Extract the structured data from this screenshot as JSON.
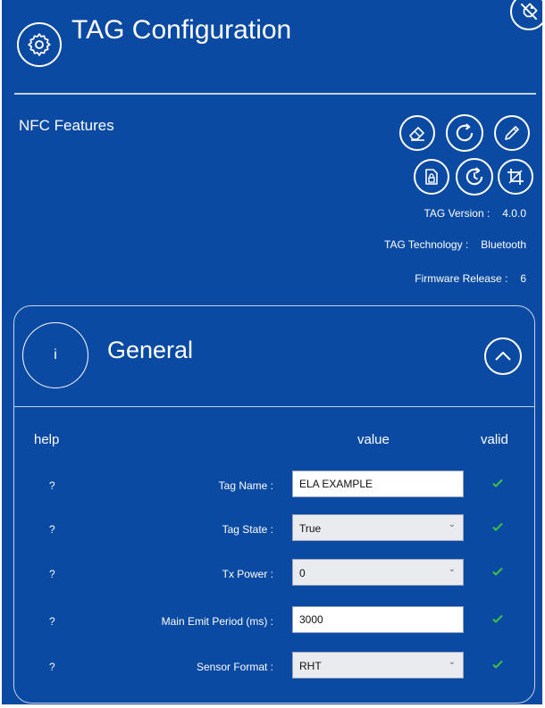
{
  "header": {
    "title": "TAG Configuration"
  },
  "nfc": {
    "title": "NFC Features",
    "info": [
      {
        "label": "TAG Version :",
        "value": "4.0.0"
      },
      {
        "label": "TAG Technology :",
        "value": "Bluetooth"
      },
      {
        "label": "Firmware Release :",
        "value": "6"
      }
    ]
  },
  "general": {
    "info_label": "i",
    "title": "General",
    "columns": {
      "help": "help",
      "value": "value",
      "valid": "valid"
    },
    "rows": [
      {
        "help": "?",
        "label": "Tag Name :",
        "value": "ELA EXAMPLE"
      },
      {
        "help": "?",
        "label": "Tag State :",
        "value": "True"
      },
      {
        "help": "?",
        "label": "Tx Power :",
        "value": "0"
      },
      {
        "help": "?",
        "label": "Main Emit Period (ms) :",
        "value": "3000"
      },
      {
        "help": "?",
        "label": "Sensor Format :",
        "value": "RHT"
      }
    ]
  },
  "colors": {
    "background": "#0a4aa3",
    "check": "#3ec43e",
    "border": "#c7d3e8"
  },
  "icons": [
    "gear-icon",
    "no-tag-icon",
    "eraser-icon",
    "refresh-icon",
    "pencil-icon",
    "lock-file-icon",
    "history-icon",
    "crop-icon",
    "chevron-up-icon",
    "check-icon",
    "chevron-down-icon"
  ]
}
